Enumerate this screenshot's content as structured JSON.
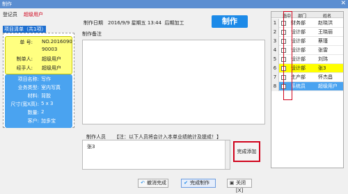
{
  "window": {
    "title": "制作",
    "close_glyph": "✕"
  },
  "login": {
    "label": "登记员",
    "user": "超级用户"
  },
  "project": {
    "title": "项目清单（共1项）",
    "top_card": [
      {
        "k": "单  号:",
        "v": "NO.2016090"
      },
      {
        "k": "",
        "v": "90003"
      },
      {
        "k": "制单人:",
        "v": "超级用户"
      },
      {
        "k": "经手人:",
        "v": "超级用户"
      }
    ],
    "bottom_card": [
      {
        "k": "项目名称:",
        "v": "写作"
      },
      {
        "k": "业务类型:",
        "v": "室内写真"
      },
      {
        "k": "材料:",
        "v": "背胶"
      },
      {
        "k": "尺寸(宽X高):",
        "v": "5 x 3"
      },
      {
        "k": "数量:",
        "v": "2"
      },
      {
        "k": "客户:",
        "v": "加多宝"
      }
    ]
  },
  "form": {
    "date_label": "制作日期",
    "date_value": "2016/9/9 星期五 13:44",
    "post_process_label": "后期加工",
    "make_button": "制作",
    "note_label": "制作备注",
    "staff_label": "制作人员",
    "staff_hint": "【注：以下人员将会计入本单业绩统计及提成！】",
    "staff_value": "张3",
    "add_button": "完成添加"
  },
  "footer": {
    "cancel": "撤消完成",
    "done": "完成制作",
    "close": "关闭[X]"
  },
  "grid": {
    "headers": [
      "选中",
      "部门",
      "姓名"
    ],
    "rows": [
      {
        "idx": "1",
        "dept": "财务部",
        "name": "赵晓洪"
      },
      {
        "idx": "2",
        "dept": "设计部",
        "name": "王晓丽"
      },
      {
        "idx": "3",
        "dept": "设计部",
        "name": "蔡瑾"
      },
      {
        "idx": "4",
        "dept": "设计部",
        "name": "张雷"
      },
      {
        "idx": "5",
        "dept": "设计部",
        "name": "刘玮"
      },
      {
        "idx": "6",
        "dept": "设计部",
        "name": "张3",
        "selected": true
      },
      {
        "idx": "7",
        "dept": "生产部",
        "name": "怀杰昌"
      },
      {
        "idx": "8",
        "dept": "系统员",
        "name": "超级用户",
        "highlight": true
      }
    ]
  },
  "colors": {
    "accent": "#1c8ae8",
    "highlight_red": "#d0021b",
    "selected_row": "#ffff00",
    "card_blue": "#4aa3f0",
    "card_yellow": "#ffff80"
  },
  "icons": {
    "cancel": "undo-icon",
    "done": "check-icon",
    "close": "close-icon"
  }
}
